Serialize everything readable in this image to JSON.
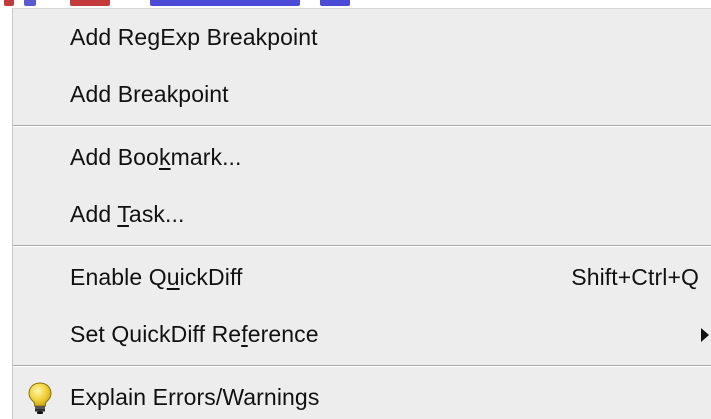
{
  "menu": {
    "group1": {
      "add_regexp_breakpoint": "Add RegExp Breakpoint",
      "add_breakpoint": "Add Breakpoint"
    },
    "group2": {
      "add_bookmark": {
        "pre": "Add Boo",
        "mnemonic": "k",
        "post": "mark..."
      },
      "add_task": {
        "pre": "Add ",
        "mnemonic": "T",
        "post": "ask..."
      }
    },
    "group3": {
      "enable_quickdiff": {
        "pre": "Enable Q",
        "mnemonic": "u",
        "post": "ickDiff",
        "shortcut": "Shift+Ctrl+Q"
      },
      "set_quickdiff_reference": {
        "pre": "Set QuickDiff Re",
        "mnemonic": "f",
        "post": "erence"
      }
    },
    "group4": {
      "explain_errors": "Explain Errors/Warnings",
      "icon": "lightbulb-icon"
    }
  },
  "colors": {
    "menu_background": "#ededed",
    "text": "#111111",
    "separator": "#a9a9a9",
    "icon_bulb": "#f2d23c"
  }
}
